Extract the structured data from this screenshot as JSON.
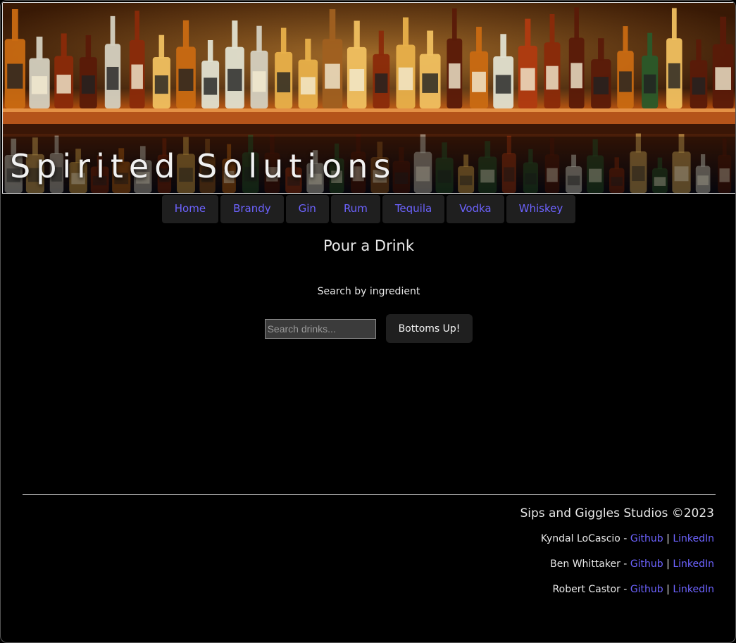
{
  "header": {
    "title": "Spirited Solutions",
    "banner_image": "liquor-bottles-shelf"
  },
  "nav": {
    "items": [
      {
        "label": "Home"
      },
      {
        "label": "Brandy"
      },
      {
        "label": "Gin"
      },
      {
        "label": "Rum"
      },
      {
        "label": "Tequila"
      },
      {
        "label": "Vodka"
      },
      {
        "label": "Whiskey"
      }
    ]
  },
  "main": {
    "title": "Pour a Drink",
    "search_label": "Search by ingredient",
    "search_placeholder": "Search drinks...",
    "search_value": "",
    "search_button": "Bottoms Up!"
  },
  "footer": {
    "studio": "Sips and Giggles Studios ©2023",
    "credits": [
      {
        "name": "Kyndal LoCascio - ",
        "github": "Github",
        "separator": " | ",
        "linkedin": "LinkedIn"
      },
      {
        "name": "Ben Whittaker - ",
        "github": "Github",
        "separator": " | ",
        "linkedin": "LinkedIn"
      },
      {
        "name": "Robert Castor - ",
        "github": "Github",
        "separator": " | ",
        "linkedin": "LinkedIn"
      }
    ]
  },
  "colors": {
    "background": "#000000",
    "link": "#6d63ff",
    "nav_bg": "#1f1f1f",
    "text": "#e8e8e8"
  }
}
